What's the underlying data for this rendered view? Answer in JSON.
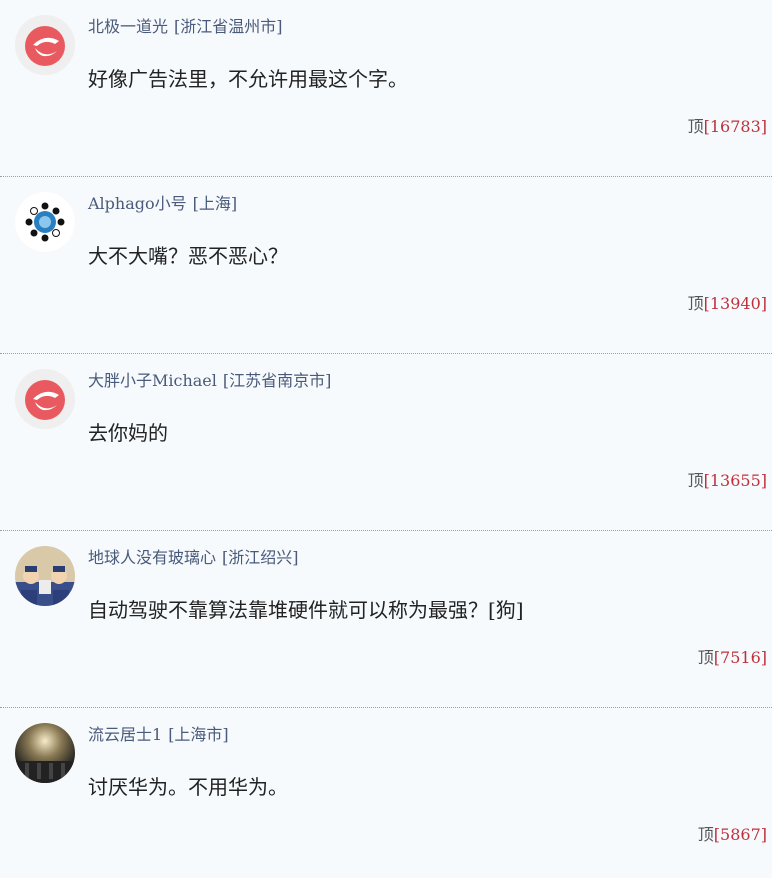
{
  "comments": [
    {
      "username": "北极一道光",
      "location": "[浙江省温州市]",
      "content": "好像广告法里，不允许用最这个字。",
      "vote_label": "顶",
      "vote_count": "[16783]"
    },
    {
      "username": "Alphago小号",
      "location": "[上海]",
      "content": "大不大嘴？恶不恶心？",
      "vote_label": "顶",
      "vote_count": "[13940]"
    },
    {
      "username": "大胖小子Michael",
      "location": "[江苏省南京市]",
      "content": "去你妈的",
      "vote_label": "顶",
      "vote_count": "[13655]"
    },
    {
      "username": "地球人没有玻璃心",
      "location": "[浙江绍兴]",
      "content": "自动驾驶不靠算法靠堆硬件就可以称为最强？[狗]",
      "vote_label": "顶",
      "vote_count": "[7516]"
    },
    {
      "username": "流云居士1",
      "location": "[上海市]",
      "content": "讨厌华为。不用华为。",
      "vote_label": "顶",
      "vote_count": "[5867]"
    }
  ],
  "colors": {
    "background": "#f6fafd",
    "username": "#4a5a7a",
    "vote_count": "#c0303a",
    "divider": "#9aa0a6"
  }
}
